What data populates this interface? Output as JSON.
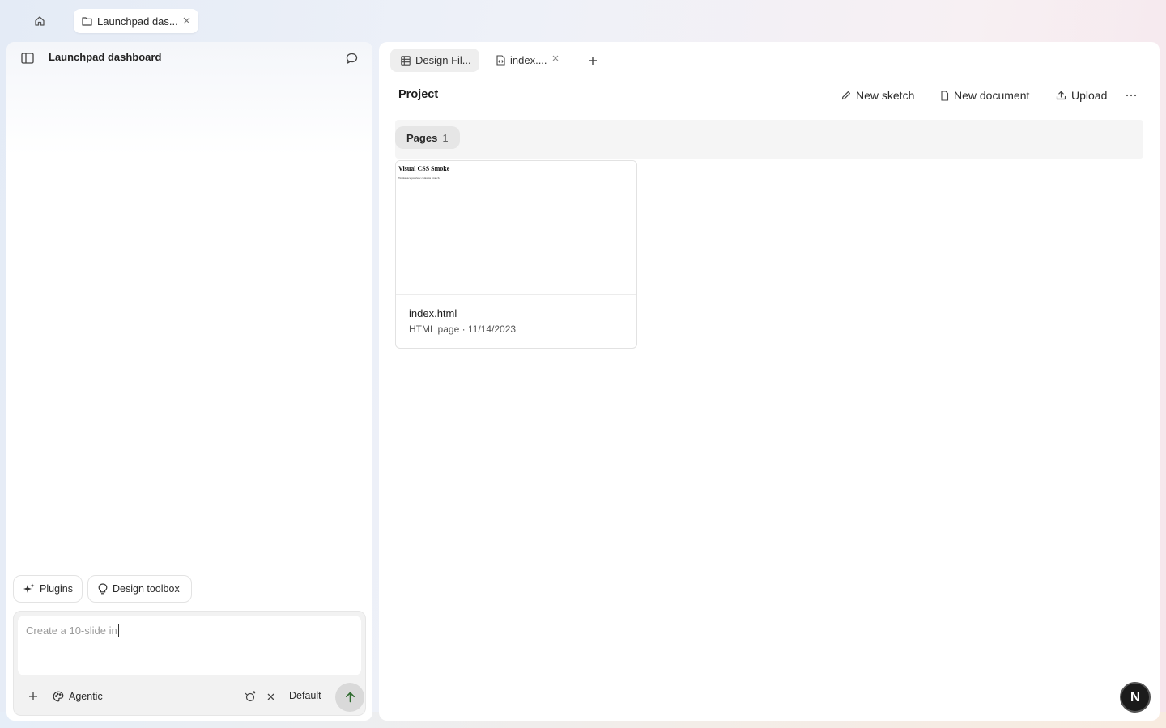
{
  "topbar": {
    "home_icon": "home-icon",
    "tab": {
      "label": "Launchpad das...",
      "icon": "folder-icon"
    }
  },
  "left_panel": {
    "title": "Launchpad dashboard",
    "chips": {
      "plugins": "Plugins",
      "design_toolbox": "Design toolbox"
    },
    "composer": {
      "input_text": "Create a 10-slide in",
      "agentic_label": "Agentic",
      "default_label": "Default"
    }
  },
  "right_panel": {
    "file_tabs": [
      {
        "label": "Design Fil...",
        "icon": "grid-icon"
      },
      {
        "label": "index....",
        "icon": "file-code-icon"
      }
    ],
    "project_title": "Project",
    "actions": {
      "new_sketch": "New sketch",
      "new_document": "New document",
      "upload": "Upload"
    },
    "pages": {
      "label": "Pages",
      "count": "1"
    },
    "card": {
      "thumb_title": "Visual CSS Smoke",
      "thumb_subtitle": "Workspace preview contains branch",
      "name": "index.html",
      "meta": "HTML page · 11/14/2023"
    }
  },
  "avatar": {
    "initial": "N"
  }
}
